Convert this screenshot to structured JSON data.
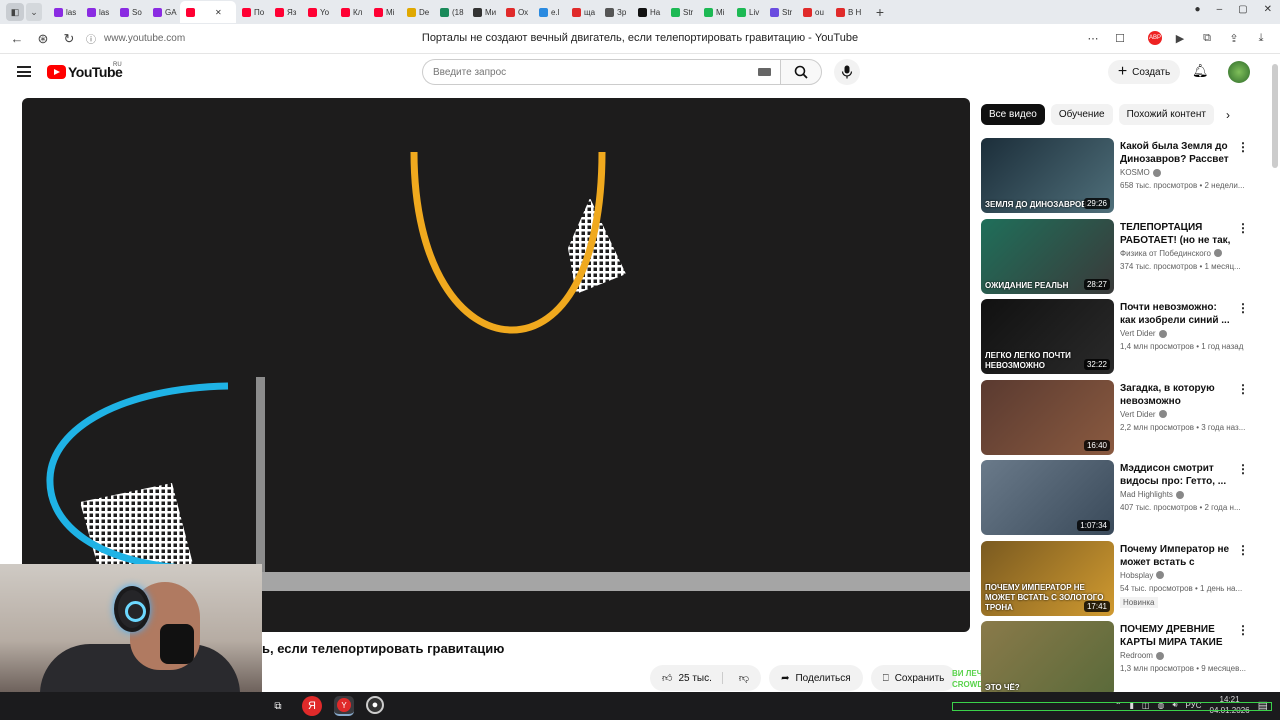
{
  "browser": {
    "tabs": [
      {
        "label": "las",
        "color": "#8a2be2"
      },
      {
        "label": "las",
        "color": "#8a2be2"
      },
      {
        "label": "So",
        "color": "#8a2be2"
      },
      {
        "label": "GA",
        "color": "#8a2be2"
      },
      {
        "label": "",
        "color": "#ff0033",
        "active": true
      },
      {
        "label": "По",
        "color": "#ff0033"
      },
      {
        "label": "Яз",
        "color": "#ff0033"
      },
      {
        "label": "Yo",
        "color": "#ff0033"
      },
      {
        "label": "Кл",
        "color": "#ff0033"
      },
      {
        "label": "Мі",
        "color": "#ff0033"
      },
      {
        "label": "De",
        "color": "#e0a800"
      },
      {
        "label": "(18",
        "color": "#1a8a5a"
      },
      {
        "label": "Ми",
        "color": "#333333"
      },
      {
        "label": "Ох",
        "color": "#e02a2a"
      },
      {
        "label": "e.l",
        "color": "#2a8ae0"
      },
      {
        "label": "ща",
        "color": "#e02a2a"
      },
      {
        "label": "Зр",
        "color": "#555555"
      },
      {
        "label": "На",
        "color": "#111111"
      },
      {
        "label": "Str",
        "color": "#1db954"
      },
      {
        "label": "Мі",
        "color": "#1db954"
      },
      {
        "label": "Liv",
        "color": "#1db954"
      },
      {
        "label": "Str",
        "color": "#6a4ce0"
      },
      {
        "label": "ou",
        "color": "#e02a2a"
      },
      {
        "label": "В Н",
        "color": "#e02a2a"
      }
    ],
    "url": "www.youtube.com",
    "page_title": "Порталы не создают вечный двигатель, если телепортировать гравитацию - YouTube",
    "abp": "ABP"
  },
  "youtube": {
    "logo_text": "YouTube",
    "region": "RU",
    "search_placeholder": "Введите запрос",
    "create_label": "Создать"
  },
  "video": {
    "title_visible": "ь, если телепортировать гравитацию",
    "likes": "25 тыс.",
    "share_label": "Поделиться",
    "save_label": "Сохранить",
    "overlay_lines": [
      "ВИ ЛЕЧЕ...",
      "CROWDFUND: 36,300 COINS...COMPLETE"
    ]
  },
  "chips": [
    "Все видео",
    "Обучение",
    "Похожий контент"
  ],
  "recommendations": [
    {
      "title": "Какой была Земля до Динозавров? Рассвет ...",
      "channel": "KOSMO",
      "meta": "658 тыс. просмотров • 2 недели...",
      "duration": "29:26",
      "thumb_text": "ЗЕМЛЯ ДО ДИНОЗАВРОВ",
      "colors": [
        "#1c2e3a",
        "#4f6f7a"
      ]
    },
    {
      "title": "ТЕЛЕПОРТАЦИЯ РАБОТАЕТ! (но не так, ...",
      "channel": "Физика от Побединского",
      "meta": "374 тыс. просмотров • 1 месяц...",
      "duration": "28:27",
      "thumb_text": "ОЖИДАНИЕ  РЕАЛЬН",
      "colors": [
        "#1f6f5a",
        "#3a3a3a"
      ]
    },
    {
      "title": "Почти невозможно: как изобрели синий ...",
      "channel": "Vert Dider",
      "meta": "1,4 млн просмотров • 1 год назад",
      "duration": "32:22",
      "thumb_text": "ЛЕГКО  ЛЕГКО  ПОЧТИ НЕВОЗМОЖНО",
      "colors": [
        "#111111",
        "#2a2a2a"
      ]
    },
    {
      "title": "Загадка, в которую невозможно поверить, ...",
      "channel": "Vert Dider",
      "meta": "2,2 млн просмотров • 3 года наз...",
      "duration": "16:40",
      "thumb_text": "",
      "colors": [
        "#5a3a30",
        "#8a5a40"
      ]
    },
    {
      "title": "Мэддисон смотрит видосы про: Гетто, ...",
      "channel": "Mad Highlights",
      "meta": "407 тыс. просмотров • 2 года н...",
      "duration": "1:07:34",
      "thumb_text": "",
      "colors": [
        "#6a7a8a",
        "#3a4a5a"
      ]
    },
    {
      "title": "Почему Император не может встать с Золото...",
      "channel": "Hobsplay",
      "meta": "54 тыс. просмотров • 1 день на...",
      "duration": "17:41",
      "badge": "Новинка",
      "thumb_text": "ПОЧЕМУ ИМПЕРАТОР НЕ МОЖЕТ ВСТАТЬ С ЗОЛОТОГО ТРОНА",
      "colors": [
        "#7a5a20",
        "#d09a30"
      ]
    },
    {
      "title": "ПОЧЕМУ ДРЕВНИЕ КАРТЫ МИРА ТАКИЕ ...",
      "channel": "Redroom",
      "meta": "1,3 млн просмотров • 9 месяцев...",
      "duration": "",
      "thumb_text": "ЭТО ЧЁ?",
      "colors": [
        "#8a7a4a",
        "#5a6a3a"
      ]
    }
  ],
  "taskbar": {
    "lang": "РУС",
    "time": "14:21",
    "date": "04.01.2026"
  }
}
